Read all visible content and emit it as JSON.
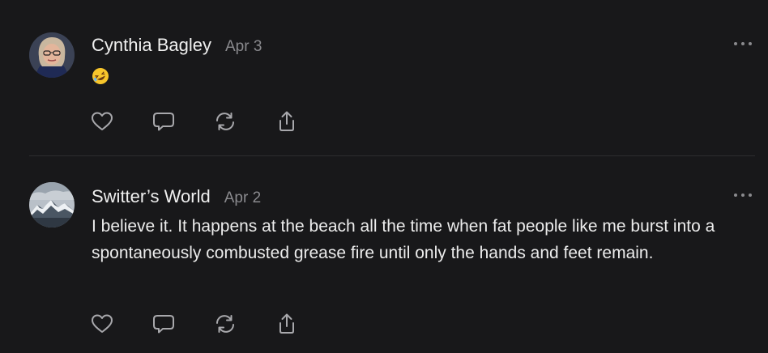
{
  "posts": [
    {
      "author": "Cynthia Bagley",
      "date": "Apr 3",
      "content_emoji": "rolling-on-floor-laughing-emoji",
      "avatar": "avatar-photo-woman-glasses",
      "actions": [
        "heart-icon",
        "comment-icon",
        "repost-icon",
        "share-icon"
      ]
    },
    {
      "author": "Switter’s World",
      "date": "Apr 2",
      "text": "I believe it. It happens at the beach all the time when fat people like me burst into a spontaneously combusted grease fire until only the hands and feet remain.",
      "avatar": "avatar-photo-snowy-mountains",
      "actions": [
        "heart-icon",
        "comment-icon",
        "repost-icon",
        "share-icon"
      ]
    }
  ],
  "colors": {
    "background": "#18181a",
    "text": "#ececec",
    "muted": "#8a8a8e",
    "divider": "#2d2d30",
    "icon": "#a8a8ac"
  }
}
